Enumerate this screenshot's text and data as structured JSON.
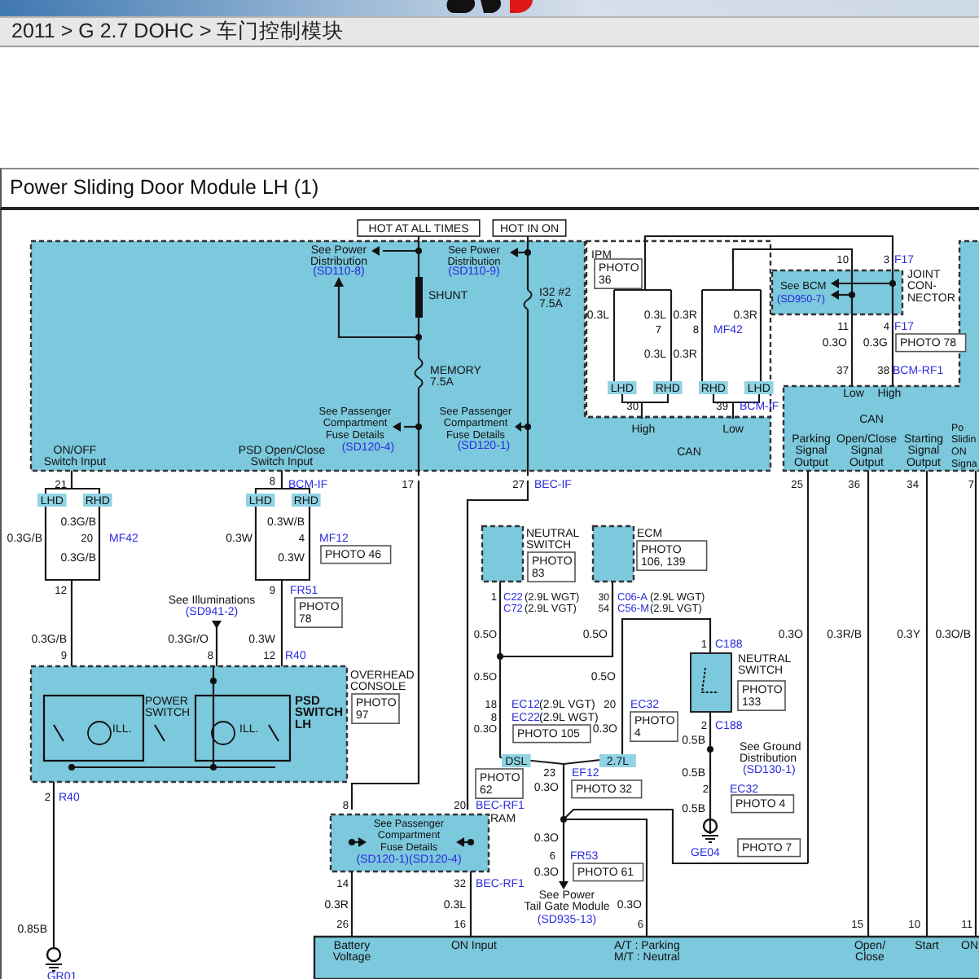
{
  "header": {
    "breadcrumb": "2011 > G 2.7 DOHC > 车门控制模块"
  },
  "panel": {
    "title": "Power Sliding Door Module LH (1)"
  },
  "diagram": {
    "labels": [
      {
        "kind": "note",
        "lines": [
          "HOT AT ALL TIMES"
        ]
      },
      {
        "kind": "note",
        "lines": [
          "HOT IN ON"
        ]
      },
      {
        "kind": "plain",
        "lines": [
          "See Power",
          "Distribution"
        ]
      },
      {
        "kind": "ref",
        "lines": [
          "(SD110-8)"
        ]
      },
      {
        "kind": "plain",
        "lines": [
          "See Power",
          "Distribution"
        ]
      },
      {
        "kind": "ref",
        "lines": [
          "(SD110-9)"
        ]
      },
      {
        "kind": "plain",
        "lines": [
          "SHUNT"
        ]
      },
      {
        "kind": "plain",
        "lines": [
          "MEMORY",
          "7.5A"
        ]
      },
      {
        "kind": "plain",
        "lines": [
          "See Passenger",
          "Compartment",
          "Fuse Details"
        ]
      },
      {
        "kind": "ref",
        "lines": [
          "(SD120-4)"
        ]
      },
      {
        "kind": "plain",
        "lines": [
          "See Passenger",
          "Compartment",
          "Fuse Details"
        ]
      },
      {
        "kind": "ref",
        "lines": [
          "(SD120-1)"
        ]
      },
      {
        "kind": "plain",
        "lines": [
          "I32 #2",
          "7.5A"
        ]
      },
      {
        "kind": "plain",
        "lines": [
          "ON/OFF",
          "Switch Input"
        ]
      },
      {
        "kind": "plain",
        "lines": [
          "PSD Open/Close",
          "Switch Input"
        ]
      },
      {
        "kind": "pin",
        "lines": [
          "21"
        ]
      },
      {
        "kind": "pin",
        "lines": [
          "8"
        ]
      },
      {
        "kind": "ref",
        "lines": [
          "BCM-IF"
        ]
      },
      {
        "kind": "pin",
        "lines": [
          "17"
        ]
      },
      {
        "kind": "pin",
        "lines": [
          "27"
        ]
      },
      {
        "kind": "ref",
        "lines": [
          "BEC-IF"
        ]
      },
      {
        "kind": "plain",
        "lines": [
          "IPM"
        ]
      },
      {
        "kind": "photo",
        "lines": [
          "PHOTO",
          "36"
        ]
      },
      {
        "kind": "plain",
        "lines": [
          "0.3L"
        ]
      },
      {
        "kind": "plain",
        "lines": [
          "0.3L"
        ]
      },
      {
        "kind": "plain",
        "lines": [
          "0.3R"
        ]
      },
      {
        "kind": "plain",
        "lines": [
          "0.3R"
        ]
      },
      {
        "kind": "pin",
        "lines": [
          "7"
        ]
      },
      {
        "kind": "pin",
        "lines": [
          "8"
        ]
      },
      {
        "kind": "ref",
        "lines": [
          "MF42"
        ]
      },
      {
        "kind": "plain",
        "lines": [
          "0.3L"
        ]
      },
      {
        "kind": "plain",
        "lines": [
          "0.3R"
        ]
      },
      {
        "kind": "tag",
        "lines": [
          "LHD"
        ]
      },
      {
        "kind": "tag",
        "lines": [
          "RHD"
        ]
      },
      {
        "kind": "tag",
        "lines": [
          "RHD"
        ]
      },
      {
        "kind": "tag",
        "lines": [
          "LHD"
        ]
      },
      {
        "kind": "pin",
        "lines": [
          "30"
        ]
      },
      {
        "kind": "pin",
        "lines": [
          "39"
        ]
      },
      {
        "kind": "ref",
        "lines": [
          "BCM-IF"
        ]
      },
      {
        "kind": "plain",
        "lines": [
          "High"
        ]
      },
      {
        "kind": "plain",
        "lines": [
          "Low"
        ]
      },
      {
        "kind": "plain",
        "lines": [
          "CAN"
        ]
      },
      {
        "kind": "pin",
        "lines": [
          "10"
        ]
      },
      {
        "kind": "pin",
        "lines": [
          "3"
        ]
      },
      {
        "kind": "ref",
        "lines": [
          "F17"
        ]
      },
      {
        "kind": "plain",
        "lines": [
          "See BCM"
        ]
      },
      {
        "kind": "ref",
        "lines": [
          "(SD950-7)"
        ]
      },
      {
        "kind": "plain",
        "lines": [
          "JOINT",
          "CON-",
          "NECTOR"
        ]
      },
      {
        "kind": "pin",
        "lines": [
          "11"
        ]
      },
      {
        "kind": "pin",
        "lines": [
          "4"
        ]
      },
      {
        "kind": "ref",
        "lines": [
          "F17"
        ]
      },
      {
        "kind": "plain",
        "lines": [
          "0.3O"
        ]
      },
      {
        "kind": "plain",
        "lines": [
          "0.3G"
        ]
      },
      {
        "kind": "photo",
        "lines": [
          "PHOTO 78"
        ]
      },
      {
        "kind": "pin",
        "lines": [
          "37"
        ]
      },
      {
        "kind": "pin",
        "lines": [
          "38"
        ]
      },
      {
        "kind": "ref",
        "lines": [
          "BCM-RF1"
        ]
      },
      {
        "kind": "plain",
        "lines": [
          "Low"
        ]
      },
      {
        "kind": "plain",
        "lines": [
          "High"
        ]
      },
      {
        "kind": "plain",
        "lines": [
          "CAN"
        ]
      },
      {
        "kind": "plain",
        "lines": [
          "Parking",
          "Signal",
          "Output"
        ]
      },
      {
        "kind": "plain",
        "lines": [
          "Open/Close",
          "Signal",
          "Output"
        ]
      },
      {
        "kind": "plain",
        "lines": [
          "Starting",
          "Signal",
          "Output"
        ]
      },
      {
        "kind": "plain",
        "lines": [
          "Po",
          "Slidin",
          "ON",
          "Signa"
        ]
      },
      {
        "kind": "pin",
        "lines": [
          "25"
        ]
      },
      {
        "kind": "pin",
        "lines": [
          "36"
        ]
      },
      {
        "kind": "pin",
        "lines": [
          "34"
        ]
      },
      {
        "kind": "pin",
        "lines": [
          "7"
        ]
      },
      {
        "kind": "tag",
        "lines": [
          "LHD"
        ]
      },
      {
        "kind": "tag",
        "lines": [
          "RHD"
        ]
      },
      {
        "kind": "tag",
        "lines": [
          "LHD"
        ]
      },
      {
        "kind": "tag",
        "lines": [
          "RHD"
        ]
      },
      {
        "kind": "plain",
        "lines": [
          "0.3G/B"
        ]
      },
      {
        "kind": "pin",
        "lines": [
          "20"
        ]
      },
      {
        "kind": "ref",
        "lines": [
          "MF42"
        ]
      },
      {
        "kind": "plain",
        "lines": [
          "0.3G/B"
        ]
      },
      {
        "kind": "plain",
        "lines": [
          "0.3G/B"
        ]
      },
      {
        "kind": "plain",
        "lines": [
          "0.3W/B"
        ]
      },
      {
        "kind": "pin",
        "lines": [
          "4"
        ]
      },
      {
        "kind": "ref",
        "lines": [
          "MF12"
        ]
      },
      {
        "kind": "plain",
        "lines": [
          "0.3W"
        ]
      },
      {
        "kind": "photo",
        "lines": [
          "PHOTO 46"
        ]
      },
      {
        "kind": "plain",
        "lines": [
          "0.3W"
        ]
      },
      {
        "kind": "pin",
        "lines": [
          "12"
        ]
      },
      {
        "kind": "pin",
        "lines": [
          "9"
        ]
      },
      {
        "kind": "ref",
        "lines": [
          "FR51"
        ]
      },
      {
        "kind": "photo",
        "lines": [
          "PHOTO",
          "78"
        ]
      },
      {
        "kind": "plain",
        "lines": [
          "See Illuminations"
        ]
      },
      {
        "kind": "ref",
        "lines": [
          "(SD941-2)"
        ]
      },
      {
        "kind": "plain",
        "lines": [
          "0.3G/B"
        ]
      },
      {
        "kind": "plain",
        "lines": [
          "0.3Gr/O"
        ]
      },
      {
        "kind": "plain",
        "lines": [
          "0.3W"
        ]
      },
      {
        "kind": "pin",
        "lines": [
          "9"
        ]
      },
      {
        "kind": "pin",
        "lines": [
          "8"
        ]
      },
      {
        "kind": "pin",
        "lines": [
          "12"
        ]
      },
      {
        "kind": "ref",
        "lines": [
          "R40"
        ]
      },
      {
        "kind": "plain",
        "lines": [
          "OVERHEAD",
          "CONSOLE"
        ]
      },
      {
        "kind": "plain",
        "lines": [
          "POWER",
          "SWITCH"
        ]
      },
      {
        "kind": "bold",
        "lines": [
          "PSD",
          "SWITCH",
          "LH"
        ]
      },
      {
        "kind": "photo",
        "lines": [
          "PHOTO",
          "97"
        ]
      },
      {
        "kind": "plain",
        "lines": [
          "ILL."
        ]
      },
      {
        "kind": "plain",
        "lines": [
          "ILL."
        ]
      },
      {
        "kind": "plain",
        "lines": [
          "NEUTRAL",
          "SWITCH"
        ]
      },
      {
        "kind": "photo",
        "lines": [
          "PHOTO",
          "83"
        ]
      },
      {
        "kind": "plain",
        "lines": [
          "ECM"
        ]
      },
      {
        "kind": "photo",
        "lines": [
          "PHOTO",
          "106, 139"
        ]
      },
      {
        "kind": "pin",
        "lines": [
          "1"
        ]
      },
      {
        "kind": "ref",
        "lines": [
          "C22"
        ]
      },
      {
        "kind": "plain",
        "lines": [
          "(2.9L WGT)"
        ]
      },
      {
        "kind": "ref",
        "lines": [
          "C72"
        ]
      },
      {
        "kind": "plain",
        "lines": [
          "(2.9L VGT)"
        ]
      },
      {
        "kind": "pin",
        "lines": [
          "30"
        ]
      },
      {
        "kind": "ref",
        "lines": [
          "C06-A"
        ]
      },
      {
        "kind": "plain",
        "lines": [
          "(2.9L WGT)"
        ]
      },
      {
        "kind": "pin",
        "lines": [
          "54"
        ]
      },
      {
        "kind": "ref",
        "lines": [
          "C56-M"
        ]
      },
      {
        "kind": "plain",
        "lines": [
          "(2.9L VGT)"
        ]
      },
      {
        "kind": "plain",
        "lines": [
          "0.5O"
        ]
      },
      {
        "kind": "plain",
        "lines": [
          "0.5O"
        ]
      },
      {
        "kind": "pin",
        "lines": [
          "1"
        ]
      },
      {
        "kind": "ref",
        "lines": [
          "C188"
        ]
      },
      {
        "kind": "plain",
        "lines": [
          "NEUTRAL",
          "SWITCH"
        ]
      },
      {
        "kind": "photo",
        "lines": [
          "PHOTO",
          "133"
        ]
      },
      {
        "kind": "plain",
        "lines": [
          "0.3O"
        ]
      },
      {
        "kind": "plain",
        "lines": [
          "0.3R/B"
        ]
      },
      {
        "kind": "plain",
        "lines": [
          "0.3Y"
        ]
      },
      {
        "kind": "plain",
        "lines": [
          "0.3O/B"
        ]
      },
      {
        "kind": "plain",
        "lines": [
          "0.5O"
        ]
      },
      {
        "kind": "plain",
        "lines": [
          "0.5O"
        ]
      },
      {
        "kind": "pin",
        "lines": [
          "18"
        ]
      },
      {
        "kind": "ref",
        "lines": [
          "EC12"
        ]
      },
      {
        "kind": "plain",
        "lines": [
          "(2.9L VGT)"
        ]
      },
      {
        "kind": "pin",
        "lines": [
          "8"
        ]
      },
      {
        "kind": "ref",
        "lines": [
          "EC22"
        ]
      },
      {
        "kind": "plain",
        "lines": [
          "(2.9L WGT)"
        ]
      },
      {
        "kind": "photo",
        "lines": [
          "PHOTO 105"
        ]
      },
      {
        "kind": "pin",
        "lines": [
          "20"
        ]
      },
      {
        "kind": "ref",
        "lines": [
          "EC32"
        ]
      },
      {
        "kind": "photo",
        "lines": [
          "PHOTO",
          "4"
        ]
      },
      {
        "kind": "pin",
        "lines": [
          "2"
        ]
      },
      {
        "kind": "ref",
        "lines": [
          "C188"
        ]
      },
      {
        "kind": "plain",
        "lines": [
          "0.3O"
        ]
      },
      {
        "kind": "plain",
        "lines": [
          "0.3O"
        ]
      },
      {
        "kind": "tag",
        "lines": [
          "DSL"
        ]
      },
      {
        "kind": "tag",
        "lines": [
          "2.7L"
        ]
      },
      {
        "kind": "plain",
        "lines": [
          "0.5B"
        ]
      },
      {
        "kind": "plain",
        "lines": [
          "See Ground",
          "Distribution"
        ]
      },
      {
        "kind": "plain",
        "lines": [
          "0.5B"
        ]
      },
      {
        "kind": "ref",
        "lines": [
          "(SD130-1)"
        ]
      },
      {
        "kind": "pin",
        "lines": [
          "2"
        ]
      },
      {
        "kind": "ref",
        "lines": [
          "EC32"
        ]
      },
      {
        "kind": "photo",
        "lines": [
          "PHOTO 4"
        ]
      },
      {
        "kind": "plain",
        "lines": [
          "0.5B"
        ]
      },
      {
        "kind": "ref",
        "lines": [
          "GE04"
        ]
      },
      {
        "kind": "photo",
        "lines": [
          "PHOTO 7"
        ]
      },
      {
        "kind": "photo",
        "lines": [
          "PHOTO",
          "62"
        ]
      },
      {
        "kind": "pin",
        "lines": [
          "23"
        ]
      },
      {
        "kind": "ref",
        "lines": [
          "EF12"
        ]
      },
      {
        "kind": "plain",
        "lines": [
          "0.3O"
        ]
      },
      {
        "kind": "photo",
        "lines": [
          "PHOTO 32"
        ]
      },
      {
        "kind": "pin",
        "lines": [
          "8"
        ]
      },
      {
        "kind": "pin",
        "lines": [
          "20"
        ]
      },
      {
        "kind": "ref",
        "lines": [
          "BEC-RF1"
        ]
      },
      {
        "kind": "plain",
        "lines": [
          "RAM"
        ]
      },
      {
        "kind": "plain",
        "lines": [
          "See Passenger",
          "Compartment",
          "Fuse Details"
        ]
      },
      {
        "kind": "ref",
        "lines": [
          "(SD120-1)(SD120-4)"
        ]
      },
      {
        "kind": "plain",
        "lines": [
          "0.3O"
        ]
      },
      {
        "kind": "pin",
        "lines": [
          "6"
        ]
      },
      {
        "kind": "ref",
        "lines": [
          "FR53"
        ]
      },
      {
        "kind": "plain",
        "lines": [
          "0.3O"
        ]
      },
      {
        "kind": "photo",
        "lines": [
          "PHOTO 61"
        ]
      },
      {
        "kind": "plain",
        "lines": [
          "See Power",
          "Tail Gate Module"
        ]
      },
      {
        "kind": "ref",
        "lines": [
          "(SD935-13)"
        ]
      },
      {
        "kind": "pin",
        "lines": [
          "14"
        ]
      },
      {
        "kind": "pin",
        "lines": [
          "32"
        ]
      },
      {
        "kind": "ref",
        "lines": [
          "BEC-RF1"
        ]
      },
      {
        "kind": "plain",
        "lines": [
          "0.3R"
        ]
      },
      {
        "kind": "plain",
        "lines": [
          "0.3L"
        ]
      },
      {
        "kind": "plain",
        "lines": [
          "0.3O"
        ]
      },
      {
        "kind": "pin",
        "lines": [
          "26"
        ]
      },
      {
        "kind": "pin",
        "lines": [
          "16"
        ]
      },
      {
        "kind": "pin",
        "lines": [
          "6"
        ]
      },
      {
        "kind": "pin",
        "lines": [
          "15"
        ]
      },
      {
        "kind": "pin",
        "lines": [
          "10"
        ]
      },
      {
        "kind": "pin",
        "lines": [
          "11"
        ]
      },
      {
        "kind": "plain",
        "lines": [
          "Battery",
          "Voltage"
        ]
      },
      {
        "kind": "plain",
        "lines": [
          "ON Input"
        ]
      },
      {
        "kind": "plain",
        "lines": [
          "A/T : Parking",
          "M/T : Neutral"
        ]
      },
      {
        "kind": "plain",
        "lines": [
          "Open/",
          "Close"
        ]
      },
      {
        "kind": "plain",
        "lines": [
          "Start"
        ]
      },
      {
        "kind": "plain",
        "lines": [
          "ON"
        ]
      },
      {
        "kind": "pin",
        "lines": [
          "2"
        ]
      },
      {
        "kind": "ref",
        "lines": [
          "R40"
        ]
      },
      {
        "kind": "plain",
        "lines": [
          "0.85B"
        ]
      },
      {
        "kind": "ref",
        "lines": [
          "GR01"
        ]
      }
    ]
  }
}
